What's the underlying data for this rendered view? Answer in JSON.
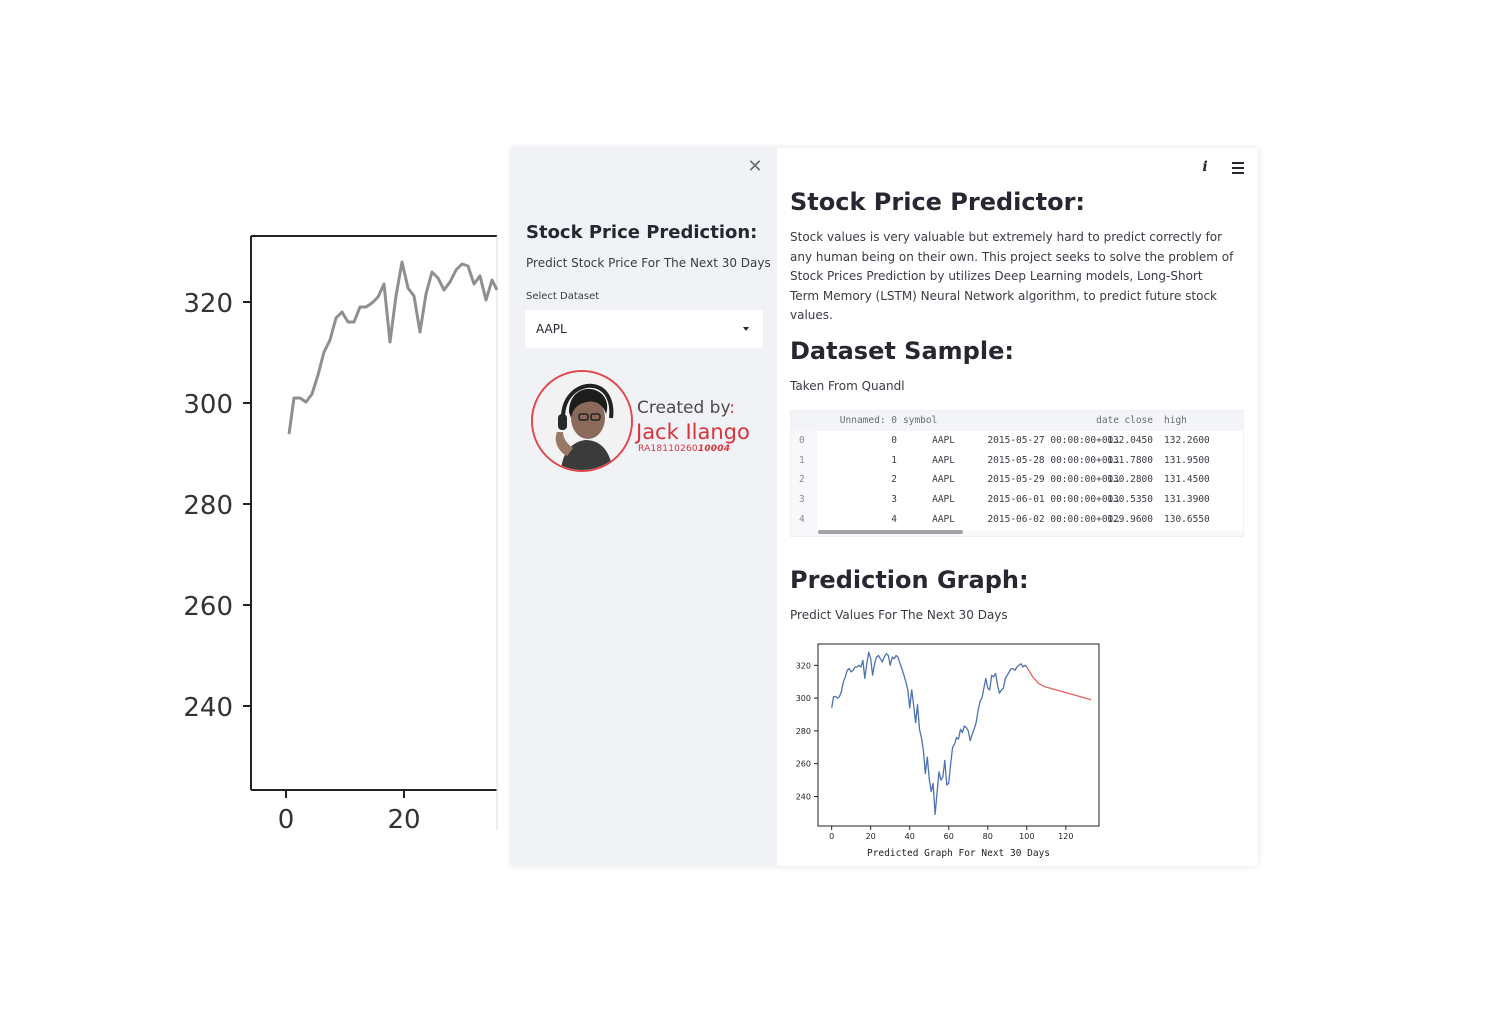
{
  "background_chart": {
    "y_ticks": [
      "320",
      "300",
      "280",
      "260",
      "240"
    ],
    "x_ticks": [
      "0",
      "20"
    ]
  },
  "sidebar": {
    "close_icon": "close-icon",
    "title": "Stock Price Prediction:",
    "subtitle": "Predict Stock Price For The Next 30 Days",
    "select_label": "Select Dataset",
    "select_value": "AAPL",
    "creator": {
      "label": "Created by",
      "colon": ":",
      "name": "Jack Ilango",
      "id_prefix": "RA18110260",
      "id_suffix": "10004"
    }
  },
  "header": {
    "about_icon": "info-icon",
    "menu_icon": "hamburger-menu-icon"
  },
  "main": {
    "title": "Stock Price Predictor:",
    "description": "Stock values is very valuable but extremely hard to predict correctly for any human being on their own. This project seeks to solve the problem of Stock Prices Prediction by utilizes Deep Learning models, Long-Short Term Memory (LSTM) Neural Network algorithm, to predict future stock values.",
    "dataset_heading": "Dataset Sample:",
    "dataset_caption": "Taken From Quandl",
    "table": {
      "columns": [
        "Unnamed: 0",
        "symbol",
        "date",
        "close",
        "high"
      ],
      "rows": [
        {
          "index": "0",
          "cells": [
            "0",
            "AAPL",
            "2015-05-27 00:00:00+00…",
            "132.0450",
            "132.2600"
          ]
        },
        {
          "index": "1",
          "cells": [
            "1",
            "AAPL",
            "2015-05-28 00:00:00+00…",
            "131.7800",
            "131.9500"
          ]
        },
        {
          "index": "2",
          "cells": [
            "2",
            "AAPL",
            "2015-05-29 00:00:00+00…",
            "130.2800",
            "131.4500"
          ]
        },
        {
          "index": "3",
          "cells": [
            "3",
            "AAPL",
            "2015-06-01 00:00:00+00…",
            "130.5350",
            "131.3900"
          ]
        },
        {
          "index": "4",
          "cells": [
            "4",
            "AAPL",
            "2015-06-02 00:00:00+00…",
            "129.9600",
            "130.6550"
          ]
        }
      ]
    },
    "graph_heading": "Prediction Graph:",
    "graph_caption": "Predict Values For The Next 30 Days"
  },
  "chart_data": {
    "type": "line",
    "title": "",
    "xlabel": "Predicted Graph For Next 30 Days",
    "ylabel": "",
    "xlim": [
      -7,
      137
    ],
    "ylim": [
      222,
      333
    ],
    "x_ticks": [
      0,
      20,
      40,
      60,
      80,
      100,
      120
    ],
    "y_ticks": [
      240,
      260,
      280,
      300,
      320
    ],
    "grid": false,
    "series": [
      {
        "color": "#4c72b0",
        "x": [
          0,
          1,
          2,
          3,
          4,
          5,
          6,
          7,
          8,
          9,
          10,
          11,
          12,
          13,
          14,
          15,
          16,
          17,
          18,
          19,
          20,
          21,
          22,
          23,
          24,
          25,
          26,
          27,
          28,
          29,
          30,
          31,
          32,
          33,
          34,
          35,
          36,
          37,
          38,
          39,
          40,
          41,
          42,
          43,
          44,
          45,
          46,
          47,
          48,
          49,
          50,
          51,
          52,
          53,
          54,
          55,
          56,
          57,
          58,
          59,
          60,
          61,
          62,
          63,
          64,
          65,
          66,
          67,
          68,
          69,
          70,
          71,
          72,
          73,
          74,
          75,
          76,
          77,
          78,
          79,
          80,
          81,
          82,
          83,
          84,
          85,
          86,
          87,
          88,
          89,
          90,
          91,
          92,
          93,
          94,
          95,
          96,
          97,
          98,
          99,
          100
        ],
        "values": [
          294,
          301,
          301,
          300,
          301,
          304,
          310,
          313,
          317,
          318,
          316,
          317,
          319,
          319,
          320,
          319,
          323,
          312,
          321,
          328,
          324,
          314,
          321,
          325,
          326,
          324,
          322,
          325,
          327,
          326,
          320,
          325,
          324,
          326,
          325,
          321,
          318,
          314,
          310,
          305,
          294,
          305,
          296,
          285,
          296,
          281,
          276,
          268,
          254,
          264,
          251,
          243,
          248,
          229,
          242,
          255,
          250,
          252,
          262,
          247,
          248,
          260,
          270,
          272,
          276,
          275,
          281,
          279,
          283,
          282,
          280,
          274,
          278,
          281,
          285,
          292,
          298,
          300,
          306,
          312,
          306,
          305,
          314,
          313,
          315,
          308,
          303,
          305,
          306,
          312,
          314,
          316,
          318,
          318,
          317,
          319,
          320,
          321,
          319,
          320,
          319
        ]
      },
      {
        "color": "#e8615e",
        "x": [
          100,
          103,
          106,
          109,
          112,
          115,
          118,
          121,
          124,
          127,
          130,
          133
        ],
        "values": [
          319,
          313,
          309,
          307,
          306,
          305,
          304,
          303,
          302,
          301,
          300,
          299
        ]
      }
    ]
  }
}
